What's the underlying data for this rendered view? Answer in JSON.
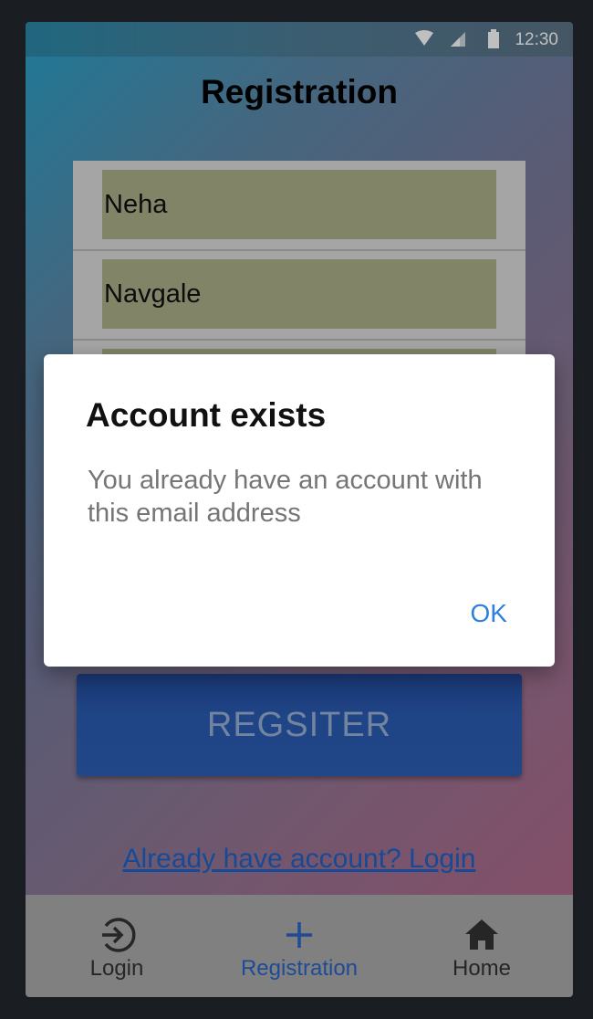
{
  "status_bar": {
    "time": "12:30"
  },
  "page": {
    "title": "Registration"
  },
  "form": {
    "first_name": "Neha",
    "last_name": "Navgale"
  },
  "register_button": {
    "label": "REGSITER"
  },
  "login_link": {
    "label": "Already have account? Login"
  },
  "bottom_nav": {
    "items": [
      {
        "label": "Login",
        "icon": "login-icon",
        "active": false
      },
      {
        "label": "Registration",
        "icon": "plus-icon",
        "active": true
      },
      {
        "label": "Home",
        "icon": "home-icon",
        "active": false
      }
    ],
    "active_color": "#2a63c8",
    "inactive_color": "#333333"
  },
  "dialog": {
    "title": "Account exists",
    "message": "You already have an account with this email address",
    "ok_label": "OK"
  },
  "colors": {
    "field_background": "#adb088",
    "button": "#2a5cb3",
    "link": "#1e63c9",
    "dialog_action": "#2f7fe0"
  }
}
